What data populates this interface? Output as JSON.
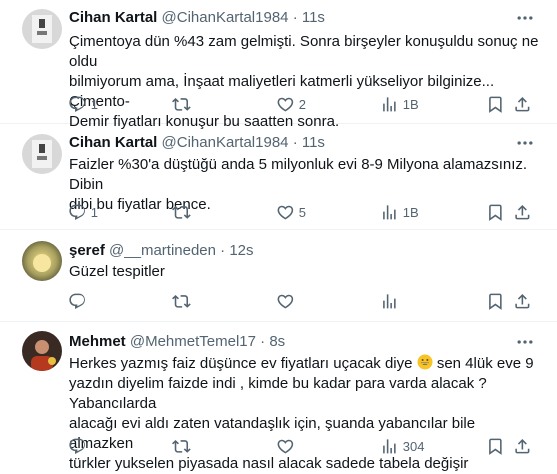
{
  "tweets": [
    {
      "name": "Cihan Kartal",
      "handle": "@CihanKartal1984",
      "time": "11s",
      "lines": [
        "Çimentoya dün %43 zam gelmişti. Sonra birşeyler konuşuldu sonuç ne oldu",
        "bilmiyorum ama, İnşaat maliyetleri katmerli yükseliyor bilginize... Çimento-",
        "Demir fiyatları konuşur bu saatten sonra."
      ],
      "replies": "1",
      "retweets": "",
      "likes": "2",
      "views": "1B"
    },
    {
      "name": "Cihan Kartal",
      "handle": "@CihanKartal1984",
      "time": "11s",
      "lines": [
        "Faizler %30'a düştüğü anda 5 milyonluk evi 8-9 Milyona alamazsınız. Dibin",
        "dibi bu fiyatlar bence."
      ],
      "replies": "1",
      "retweets": "",
      "likes": "5",
      "views": "1B"
    },
    {
      "name": "şeref",
      "handle": "@__martineden",
      "time": "12s",
      "lines": [
        "Güzel tespitler"
      ],
      "replies": "",
      "retweets": "",
      "likes": "",
      "views": ""
    },
    {
      "name": "Mehmet",
      "handle": "@MehmetTemel17",
      "time": "8s",
      "line1_a": "Herkes yazmış faiz düşünce ev fiyatları uçacak diye",
      "line1_b": " sen 4lük eve 9",
      "lines_rest": [
        "yazdın diyelim faizde indi , kimde bu kadar para varda alacak ? Yabancılarda",
        "alacağı evi aldı zaten vatandaşlık için, şuanda yabancılar bile almazken",
        "türkler yukselen piyasada nasıl alacak sadede tabela değişir"
      ],
      "replies": "",
      "retweets": "",
      "likes": "",
      "views": "304"
    }
  ],
  "separator": "·",
  "colors": {
    "text": "#0f1419",
    "secondary": "#536471",
    "border": "#eff3f4"
  },
  "icons": [
    "more-icon",
    "reply-icon",
    "retweet-icon",
    "like-icon",
    "views-icon",
    "bookmark-icon",
    "share-icon",
    "grinning-emoji"
  ]
}
